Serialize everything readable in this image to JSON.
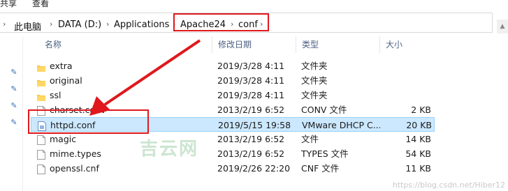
{
  "ribbon": {
    "left_label": "共享",
    "right_label": "查看"
  },
  "address": {
    "crumbs": [
      "此电脑",
      "DATA (D:)",
      "Applications",
      "Apache24",
      "conf"
    ]
  },
  "columns": {
    "name": "名称",
    "date": "修改日期",
    "type": "类型",
    "size": "大小"
  },
  "files": [
    {
      "name": "extra",
      "date": "2019/3/28 4:11",
      "type": "文件夹",
      "size": "",
      "icon": "folder-icon"
    },
    {
      "name": "original",
      "date": "2019/3/28 4:11",
      "type": "文件夹",
      "size": "",
      "icon": "folder-icon"
    },
    {
      "name": "ssl",
      "date": "2019/3/28 4:11",
      "type": "文件夹",
      "size": "",
      "icon": "folder-icon"
    },
    {
      "name": "charset.conv",
      "date": "2013/2/19 6:52",
      "type": "CONV 文件",
      "size": "2 KB",
      "icon": "file-icon"
    },
    {
      "name": "httpd.conf",
      "date": "2019/5/15 19:58",
      "type": "VMware DHCP C...",
      "size": "20 KB",
      "icon": "config-file-icon"
    },
    {
      "name": "magic",
      "date": "2013/2/19 6:52",
      "type": "文件",
      "size": "14 KB",
      "icon": "file-icon"
    },
    {
      "name": "mime.types",
      "date": "2013/2/19 6:52",
      "type": "TYPES 文件",
      "size": "54 KB",
      "icon": "file-icon"
    },
    {
      "name": "openssl.cnf",
      "date": "2019/2/26 22:20",
      "type": "CNF 文件",
      "size": "11 KB",
      "icon": "file-icon"
    }
  ],
  "selected_index": 4,
  "watermark": "吉云网",
  "credit": "https://blog.csdn.net/Hiber12",
  "colors": {
    "annotation": "#e0181d",
    "selection": "#cce8ff",
    "folder": "#f7c948"
  }
}
